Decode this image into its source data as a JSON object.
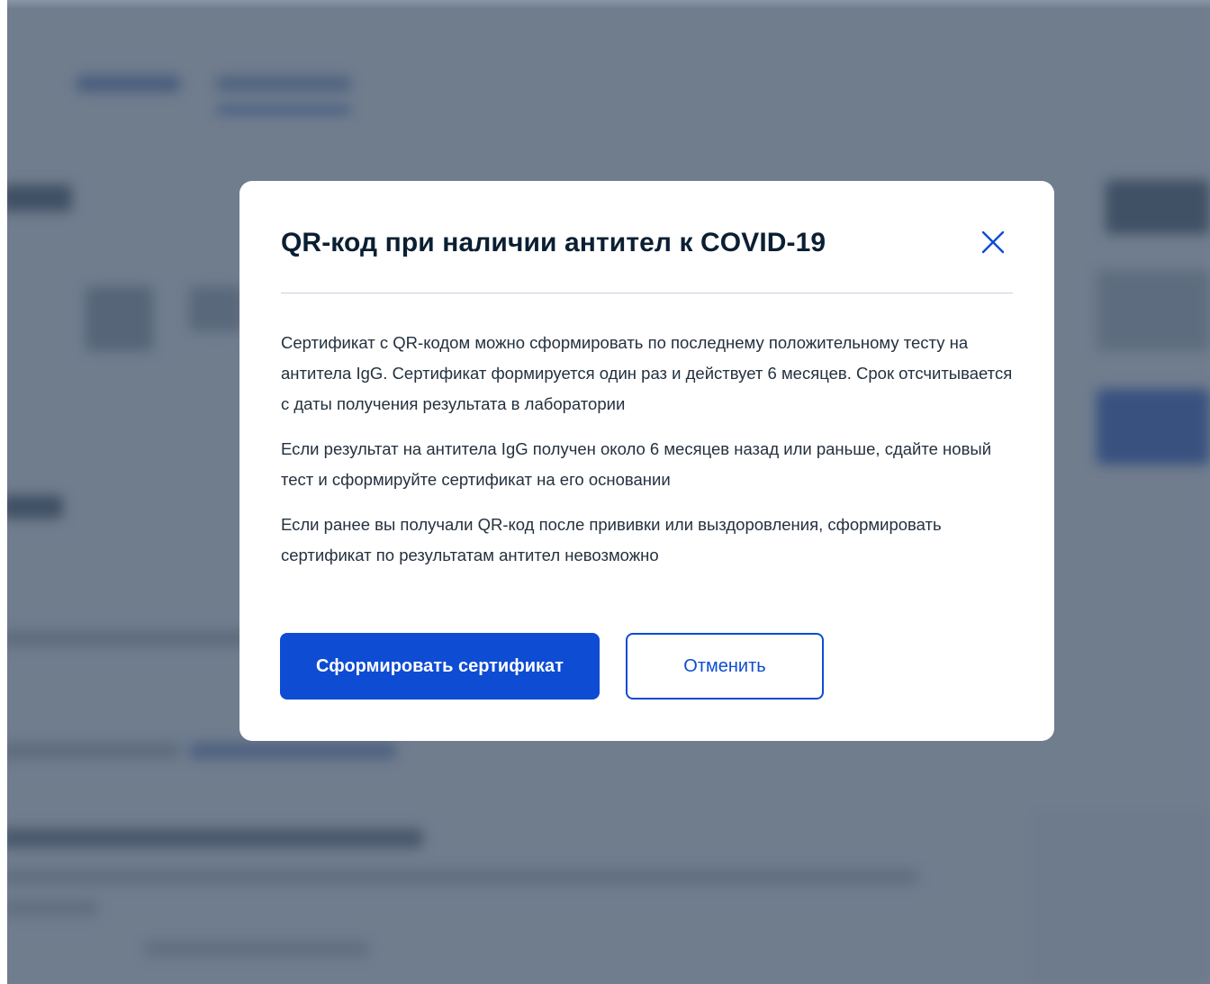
{
  "modal": {
    "title": "QR-код при наличии антител к COVID-19",
    "close_icon": "close-icon",
    "paragraphs": [
      "Сертификат с QR-кодом можно сформировать по последнему положительному тесту на антитела IgG. Сертификат формируется один раз и действует 6 месяцев. Срок отсчитывается с даты получения результата в лаборатории",
      "Если результат на антитела IgG получен около 6 месяцев назад или раньше, сдайте новый тест и сформируйте сертификат на его основании",
      "Если ранее вы получали QR-код после прививки или выздоровления, сформировать сертификат по результатам антител невозможно"
    ],
    "primary_button": "Сформировать сертификат",
    "cancel_button": "Отменить"
  },
  "colors": {
    "primary": "#0d4cd3",
    "title_text": "#0b1f33",
    "body_text": "#24313f",
    "overlay": "#66768a"
  }
}
